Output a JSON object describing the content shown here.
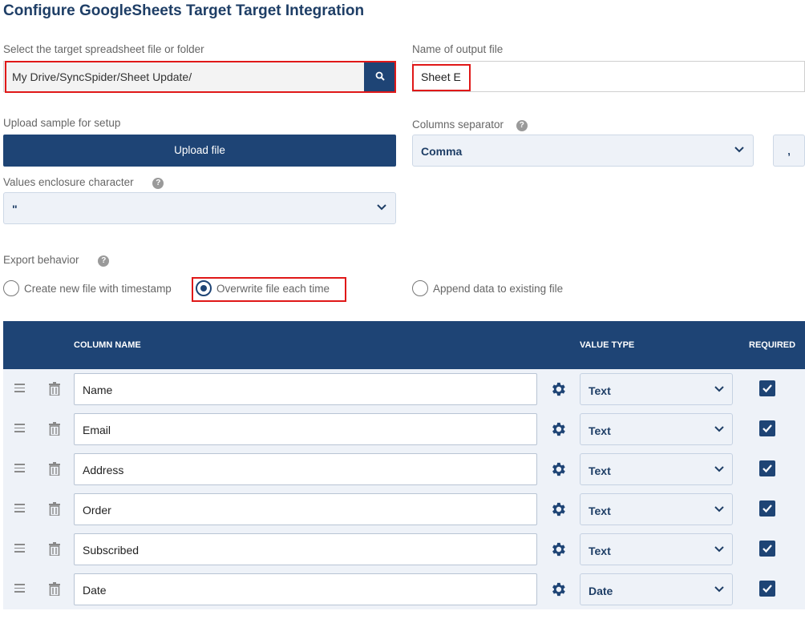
{
  "page": {
    "title": "Configure GoogleSheets Target Target Integration"
  },
  "target_file": {
    "label": "Select the target spreadsheet file or folder",
    "value": "My Drive/SyncSpider/Sheet Update/",
    "search_icon": "search-icon"
  },
  "output_file": {
    "label": "Name of output file",
    "value": "Sheet E"
  },
  "upload": {
    "label": "Upload sample for setup",
    "button": "Upload file"
  },
  "separator": {
    "label": "Columns separator",
    "help": "?",
    "selected": "Comma",
    "preview": ","
  },
  "enclosure": {
    "label": "Values enclosure character",
    "help": "?",
    "selected": "\""
  },
  "export_behavior": {
    "label": "Export behavior",
    "help": "?",
    "options": [
      {
        "label": "Create new file with timestamp",
        "selected": false
      },
      {
        "label": "Overwrite file each time",
        "selected": true
      },
      {
        "label": "Append data to existing file",
        "selected": false
      }
    ]
  },
  "table": {
    "headers": {
      "column_name": "COLUMN NAME",
      "value_type": "VALUE TYPE",
      "required": "REQUIRED"
    },
    "rows": [
      {
        "name": "Name",
        "type": "Text",
        "required": true
      },
      {
        "name": "Email",
        "type": "Text",
        "required": true
      },
      {
        "name": "Address",
        "type": "Text",
        "required": true
      },
      {
        "name": "Order",
        "type": "Text",
        "required": true
      },
      {
        "name": "Subscribed",
        "type": "Text",
        "required": true
      },
      {
        "name": "Date",
        "type": "Date",
        "required": true
      }
    ]
  },
  "colors": {
    "primary": "#1e4475",
    "title": "#1e3e66",
    "highlight": "#e01818",
    "select_bg": "#eef2f8"
  }
}
